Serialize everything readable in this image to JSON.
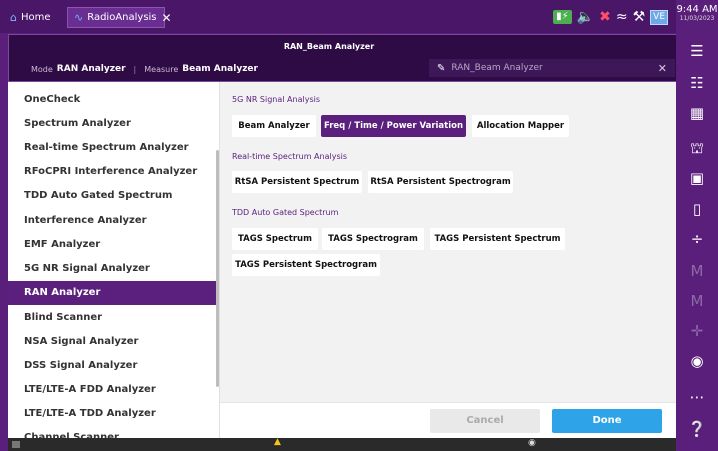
{
  "tabs": {
    "home": "Home",
    "radio": "RadioAnalysis",
    "close": "✕"
  },
  "status": {
    "time": "9:44 AM",
    "date": "11/03/2023",
    "ve_badge": "VE"
  },
  "window": {
    "title": "RAN_Beam Analyzer",
    "mode_label": "Mode",
    "mode_value": "RAN Analyzer",
    "measure_label": "Measure",
    "measure_value": "Beam Analyzer",
    "name_field_value": "RAN_Beam Analyzer",
    "name_field_clear": "✕"
  },
  "sidebar": {
    "items": [
      "OneCheck",
      "Spectrum Analyzer",
      "Real-time Spectrum Analyzer",
      "RFoCPRI Interference Analyzer",
      "TDD Auto Gated Spectrum",
      "Interference Analyzer",
      "EMF Analyzer",
      "5G NR Signal Analyzer",
      "RAN Analyzer",
      "Blind Scanner",
      "NSA Signal Analyzer",
      "DSS Signal Analyzer",
      "LTE/LTE-A FDD Analyzer",
      "LTE/LTE-A TDD Analyzer",
      "Channel Scanner"
    ],
    "selected": "RAN Analyzer"
  },
  "sections": [
    {
      "title": "5G NR Signal Analysis",
      "buttons": [
        "Beam Analyzer",
        "Freq / Time / Power Variation",
        "Allocation Mapper"
      ],
      "active": "Freq / Time / Power Variation"
    },
    {
      "title": "Real-time Spectrum Analysis",
      "buttons": [
        "RtSA Persistent Spectrum",
        "RtSA Persistent Spectrogram"
      ]
    },
    {
      "title": "TDD Auto Gated Spectrum",
      "buttons": [
        "TAGS Spectrum",
        "TAGS Spectrogram",
        "TAGS Persistent Spectrum",
        "TAGS Persistent Spectrogram"
      ]
    }
  ],
  "footer": {
    "cancel": "Cancel",
    "done": "Done"
  },
  "colors": {
    "brand_purple": "#5b1f7e",
    "done_blue": "#2ea3e8"
  },
  "icons": [
    "home-icon",
    "wave-icon",
    "battery-icon",
    "speaker-icon",
    "mute-icon",
    "wifi-icon",
    "tools-icon",
    "menu-icon",
    "settings-sliders-icon",
    "grid-icon",
    "lock-icon",
    "save-icon",
    "folder-icon",
    "divide-icon",
    "marker-icon",
    "peak-icon",
    "screenshot-icon",
    "more-icon",
    "help-icon",
    "warning-icon",
    "location-icon"
  ]
}
